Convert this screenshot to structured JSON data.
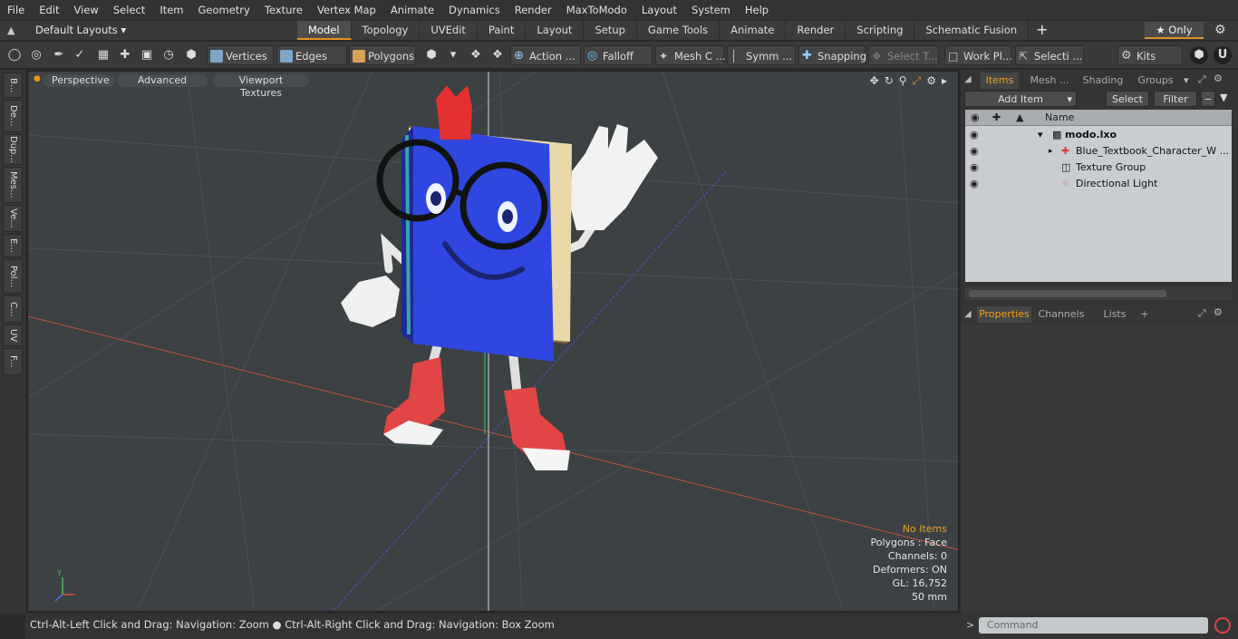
{
  "menu": [
    "File",
    "Edit",
    "View",
    "Select",
    "Item",
    "Geometry",
    "Texture",
    "Vertex Map",
    "Animate",
    "Dynamics",
    "Render",
    "MaxToModo",
    "Layout",
    "System",
    "Help"
  ],
  "layout_bar": {
    "layouts_label": "Default Layouts ▾",
    "tabs": [
      "Model",
      "Topology",
      "UVEdit",
      "Paint",
      "Layout",
      "Setup",
      "Game Tools",
      "Animate",
      "Render",
      "Scripting",
      "Schematic Fusion"
    ],
    "active_tab": "Model",
    "add_tab": "+",
    "only_label": "★ Only"
  },
  "toolbar": {
    "vertices": "Vertices",
    "edges": "Edges",
    "polygons": "Polygons",
    "action": "Action ...",
    "falloff": "Falloff",
    "mesh": "Mesh C ...",
    "symm": "Symm ...",
    "snapping": "Snapping",
    "select_t": "Select T...",
    "work_pl": "Work Pl...",
    "selecti": "Selecti ...",
    "kits": "Kits"
  },
  "left_tabs": [
    "B...",
    "De...",
    "Dup...",
    "Mes...",
    "Ve...",
    "E...",
    "Pol...",
    "C...",
    "UV",
    "F..."
  ],
  "viewport": {
    "perspective": "Perspective",
    "advanced": "Advanced",
    "viewport_textures": "Viewport Textures",
    "info": {
      "no_items": "No Items",
      "polygons": "Polygons : Face",
      "channels": "Channels: 0",
      "deformers": "Deformers: ON",
      "gl": "GL: 16,752",
      "focal": "50 mm"
    }
  },
  "status": "Ctrl-Alt-Left Click and Drag: Navigation: Zoom ● Ctrl-Alt-Right Click and Drag: Navigation: Box Zoom",
  "right_panel": {
    "tabs": [
      "Items",
      "Mesh ...",
      "Shading",
      "Groups"
    ],
    "active_tab": "Items",
    "add_item": "Add Item",
    "select": "Select",
    "filter": "Filter",
    "name_col": "Name",
    "tree": [
      {
        "name": "modo.lxo"
      },
      {
        "name": "Blue_Textbook_Character_W ..."
      },
      {
        "name": "Texture Group"
      },
      {
        "name": "Directional Light"
      }
    ],
    "prop_tabs": [
      "Properties",
      "Channels",
      "Lists",
      "+"
    ],
    "command_placeholder": "Command"
  },
  "colors": {
    "accent": "#e2931b",
    "viewport_bg": "#3c4144",
    "book_blue": "#2f47e0",
    "shoe_red": "#e03a3a"
  }
}
